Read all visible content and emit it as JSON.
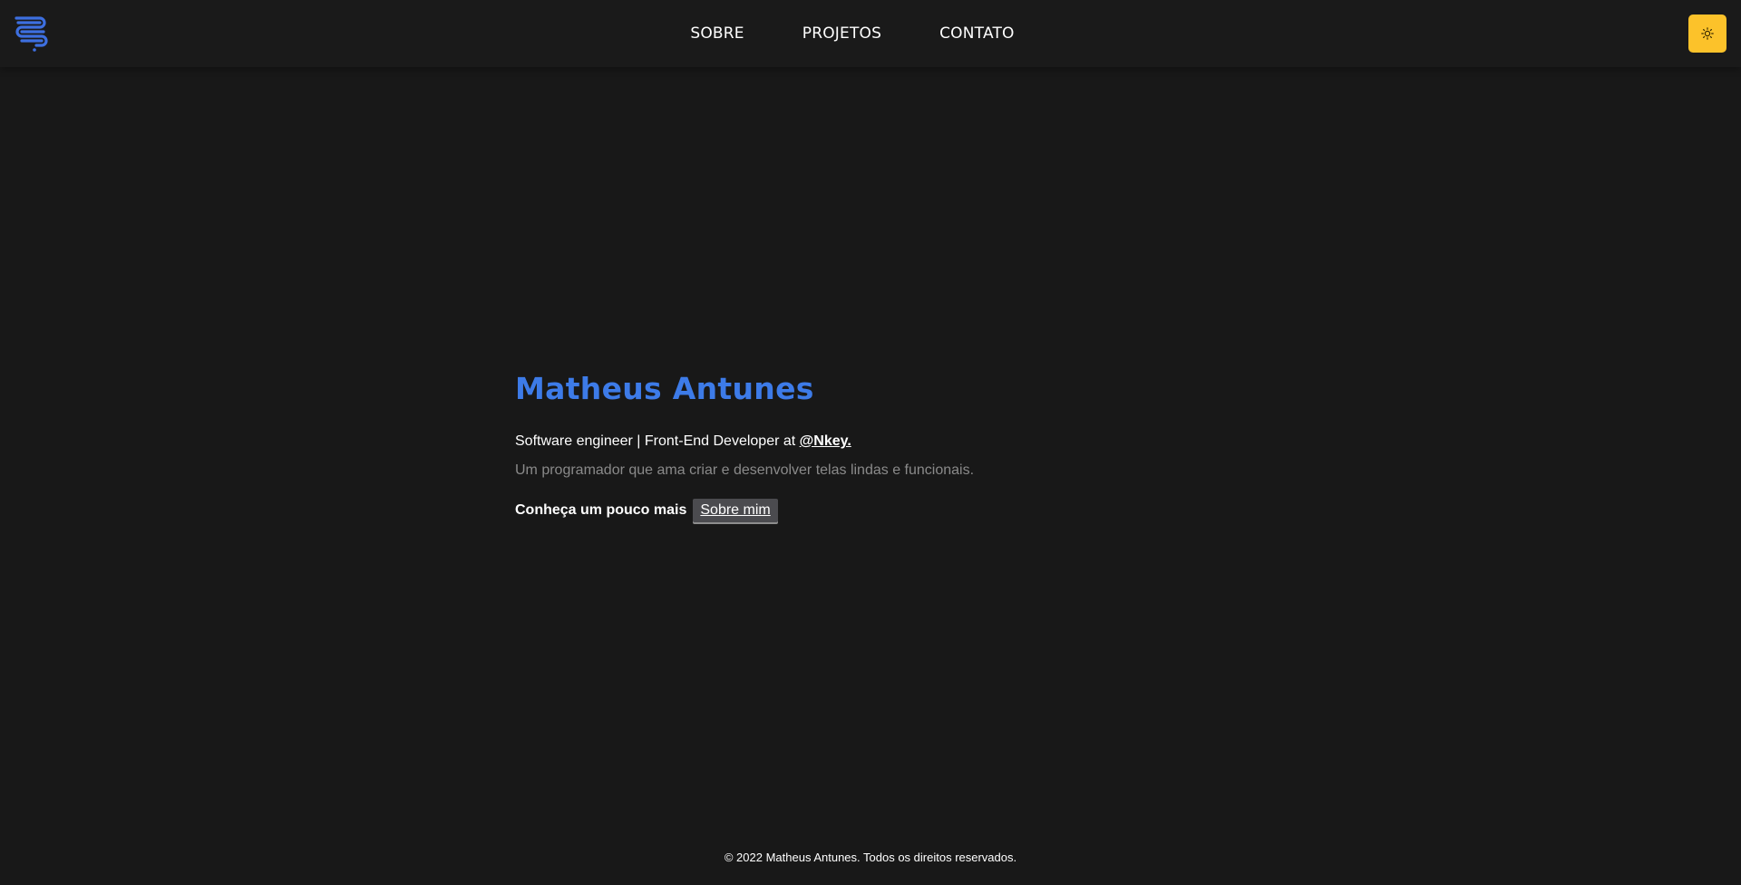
{
  "header": {
    "nav": [
      {
        "label": "SOBRE"
      },
      {
        "label": "PROJETOS"
      },
      {
        "label": "CONTATO"
      }
    ],
    "theme_toggle_icon": "sun-icon",
    "logo_icon": "logo-icon"
  },
  "hero": {
    "name": "Matheus Antunes",
    "role_prefix": "Software engineer | Front-End Developer at ",
    "company": "@Nkey.",
    "description": "Um programador que ama criar e desenvolver telas lindas e funcionais.",
    "cta_label": "Conheça um pouco mais",
    "cta_button": "Sobre mim"
  },
  "footer": {
    "copyright": "© 2022 Matheus Antunes. Todos os direitos reservados."
  },
  "colors": {
    "background": "#181818",
    "accent": "#3d7be8",
    "toggle": "#fcc22a",
    "muted_text": "#8a8a8a",
    "button_bg": "#4b4b4f"
  }
}
